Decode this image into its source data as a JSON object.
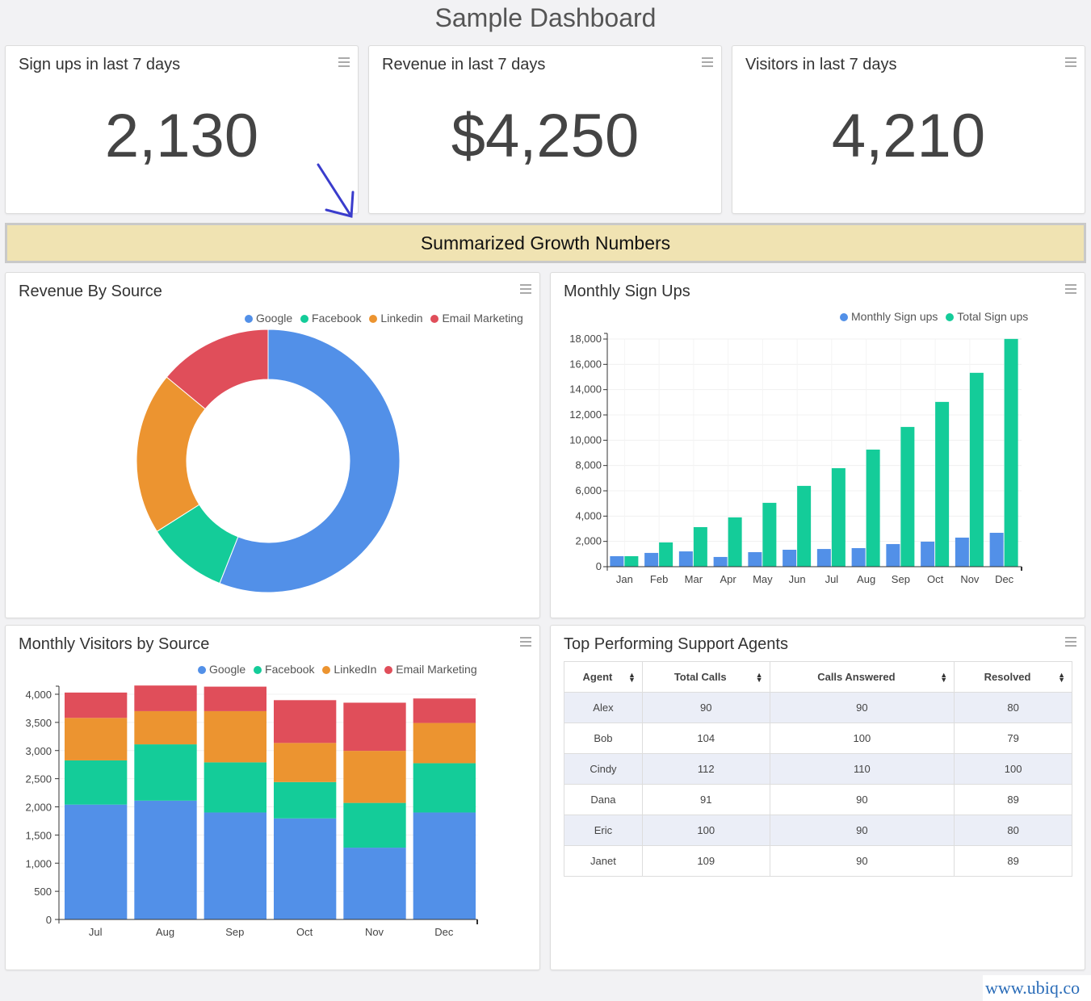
{
  "page": {
    "title": "Sample Dashboard"
  },
  "kpis": [
    {
      "title": "Sign ups in last 7 days",
      "value": "2,130"
    },
    {
      "title": "Revenue in last 7 days",
      "value": "$4,250"
    },
    {
      "title": "Visitors in last 7 days",
      "value": "4,210"
    }
  ],
  "banner": {
    "text": "Summarized Growth Numbers"
  },
  "colors": {
    "google": "#5290e8",
    "facebook": "#14cc99",
    "linkedin": "#ec9430",
    "email": "#e04e5a"
  },
  "chart_data": [
    {
      "type": "pie",
      "title": "Revenue By Source",
      "donut": true,
      "legend": "top-right",
      "categories": [
        "Google",
        "Facebook",
        "Linkedin",
        "Email Marketing"
      ],
      "values": [
        56,
        10,
        20,
        14
      ],
      "colors": [
        "#5290e8",
        "#14cc99",
        "#ec9430",
        "#e04e5a"
      ]
    },
    {
      "type": "bar",
      "title": "Monthly Sign Ups",
      "legend": "top-right",
      "categories": [
        "Jan",
        "Feb",
        "Mar",
        "Apr",
        "May",
        "Jun",
        "Jul",
        "Aug",
        "Sep",
        "Oct",
        "Nov",
        "Dec"
      ],
      "series": [
        {
          "name": "Monthly Sign ups",
          "color": "#5290e8",
          "values": [
            830,
            1090,
            1210,
            770,
            1150,
            1340,
            1400,
            1470,
            1790,
            1980,
            2300,
            2680
          ]
        },
        {
          "name": "Total Sign ups",
          "color": "#14cc99",
          "values": [
            830,
            1920,
            3130,
            3900,
            5050,
            6390,
            7790,
            9260,
            11050,
            13030,
            15330,
            18010
          ]
        }
      ],
      "ylim": [
        0,
        18000
      ],
      "yticks": [
        "0",
        "2,000",
        "4,000",
        "6,000",
        "8,000",
        "10,000",
        "12,000",
        "14,000",
        "16,000",
        "18,000"
      ],
      "grid": true
    },
    {
      "type": "bar",
      "stacked": true,
      "title": "Monthly Visitors by Source",
      "legend": "top-right",
      "categories": [
        "Jul",
        "Aug",
        "Sep",
        "Oct",
        "Nov",
        "Dec"
      ],
      "series": [
        {
          "name": "Google",
          "color": "#5290e8",
          "values": [
            2040,
            2110,
            1900,
            1795,
            1275,
            1900
          ]
        },
        {
          "name": "Facebook",
          "color": "#14cc99",
          "values": [
            785,
            1000,
            890,
            645,
            795,
            875
          ]
        },
        {
          "name": "LinkedIn",
          "color": "#ec9430",
          "values": [
            755,
            590,
            910,
            695,
            925,
            715
          ]
        },
        {
          "name": "Email Marketing",
          "color": "#e04e5a",
          "values": [
            450,
            455,
            435,
            760,
            855,
            435
          ]
        }
      ],
      "ylim": [
        0,
        4000
      ],
      "yticks": [
        "0",
        "500",
        "1,000",
        "1,500",
        "2,000",
        "2,500",
        "3,000",
        "3,500",
        "4,000"
      ],
      "grid": true
    }
  ],
  "agents_table": {
    "title": "Top Performing Support Agents",
    "columns": [
      "Agent",
      "Total Calls",
      "Calls Answered",
      "Resolved"
    ],
    "rows": [
      [
        "Alex",
        "90",
        "90",
        "80"
      ],
      [
        "Bob",
        "104",
        "100",
        "79"
      ],
      [
        "Cindy",
        "112",
        "110",
        "100"
      ],
      [
        "Dana",
        "91",
        "90",
        "89"
      ],
      [
        "Eric",
        "100",
        "90",
        "80"
      ],
      [
        "Janet",
        "109",
        "90",
        "89"
      ]
    ]
  },
  "watermark": "www.ubiq.co"
}
